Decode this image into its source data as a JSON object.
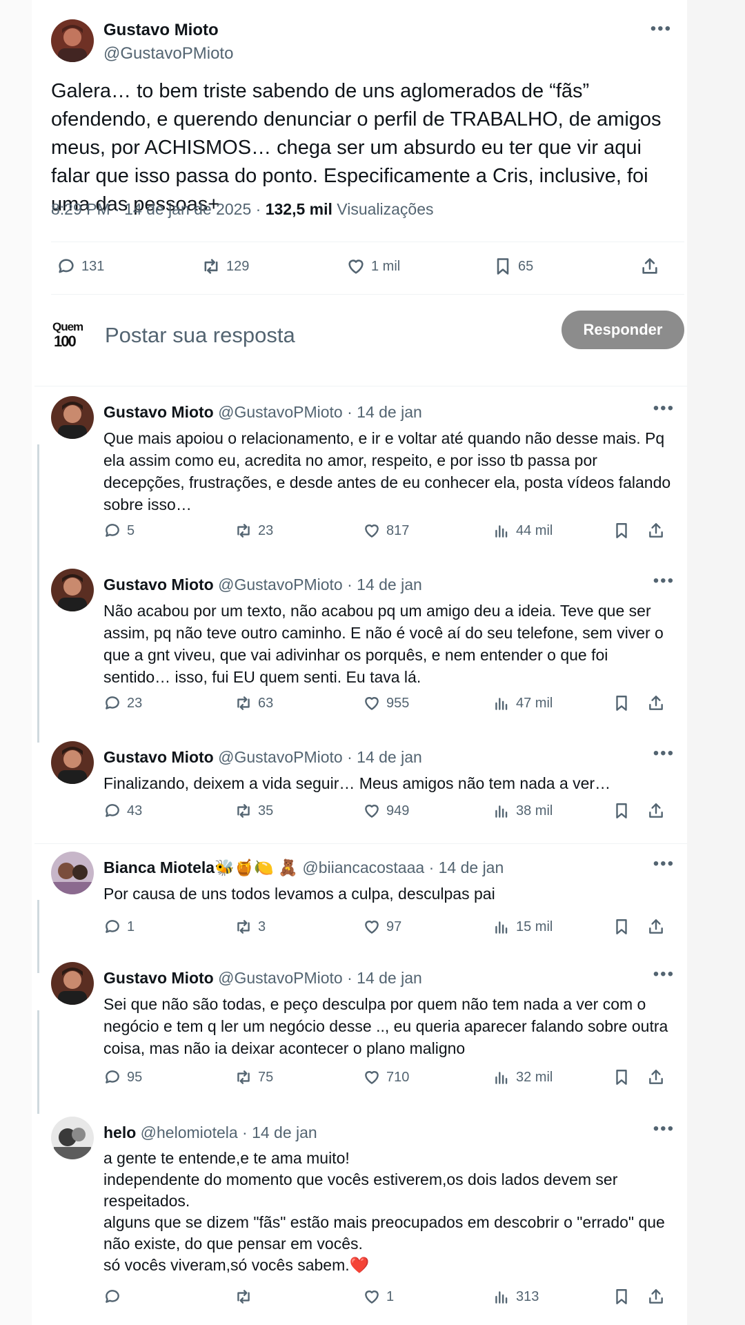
{
  "main_tweet": {
    "name": "Gustavo Mioto",
    "handle": "@GustavoPMioto",
    "text": "Galera… to bem triste sabendo de uns aglomerados de “fãs” ofendendo, e querendo denunciar o perfil de TRABALHO, de amigos meus, por ACHISMOS… chega ser um absurdo eu ter que vir aqui falar que isso passa do ponto. Especificamente a Cris, inclusive, foi uma das pessoas+",
    "time": "8:29 PM · 14 de jan de 2025 · ",
    "views_count": "132,5 mil",
    "views_label": " Visualizações",
    "replies": "131",
    "retweets": "129",
    "likes": "1 mil",
    "bookmarks": "65"
  },
  "reply_box": {
    "logo_top": "Quem",
    "logo_bottom": "100",
    "placeholder": "Postar sua resposta",
    "button": "Responder"
  },
  "replies": [
    {
      "name": "Gustavo Mioto",
      "handle": "@GustavoPMioto · 14 de jan",
      "text": "Que mais apoiou o relacionamento, e ir e voltar até quando não desse mais. Pq ela assim como eu, acredita no amor, respeito, e por isso tb passa por decepções, frustrações, e desde antes de eu conhecer ela, posta vídeos falando sobre isso…",
      "replies": "5",
      "retweets": "23",
      "likes": "817",
      "views": "44 mil"
    },
    {
      "name": "Gustavo Mioto",
      "handle": "@GustavoPMioto · 14 de jan",
      "text": "Não acabou por um texto, não acabou pq um amigo deu a ideia. Teve que ser assim, pq não teve outro caminho. E não é você aí do seu telefone, sem viver o que a gnt viveu, que vai adivinhar os porquês, e nem entender o que foi sentido… isso, fui EU quem senti. Eu tava lá.",
      "replies": "23",
      "retweets": "63",
      "likes": "955",
      "views": "47 mil"
    },
    {
      "name": "Gustavo Mioto",
      "handle": "@GustavoPMioto · 14 de jan",
      "text": "Finalizando, deixem a vida seguir…  Meus amigos não tem nada a ver…",
      "replies": "43",
      "retweets": "35",
      "likes": "949",
      "views": "38 mil"
    },
    {
      "name": "Bianca Miotela🐝🍯🍋 🧸",
      "handle": "@biiancacostaaa · 14 de jan",
      "text": "Por causa de uns todos levamos a culpa, desculpas pai",
      "replies": "1",
      "retweets": "3",
      "likes": "97",
      "views": "15 mil"
    },
    {
      "name": "Gustavo Mioto",
      "handle": "@GustavoPMioto · 14 de jan",
      "text": "Sei que não são todas, e peço desculpa por quem não tem nada a ver com o negócio e tem q ler um negócio desse .., eu queria aparecer falando sobre outra coisa, mas não ia deixar acontecer o plano maligno",
      "replies": "95",
      "retweets": "75",
      "likes": "710",
      "views": "32 mil"
    },
    {
      "name": "helo",
      "handle": "@helomiotela · 14 de jan",
      "lines": [
        "a gente te entende,e te ama muito!",
        "independente do momento que vocês estiverem,os dois lados devem ser respeitados.",
        "alguns que se dizem \"fãs\" estão mais preocupados em descobrir o \"errado\" que não existe, do que pensar em vocês.",
        "só vocês viveram,só vocês sabem.❤️"
      ],
      "replies": "",
      "retweets": "",
      "likes": "1",
      "views": "313"
    }
  ],
  "icons": {
    "reply": "reply-bubble-icon",
    "retweet": "retweet-icon",
    "like": "heart-icon",
    "views": "views-chart-icon",
    "bookmark": "bookmark-icon",
    "share": "share-icon",
    "more": "more-dots-icon"
  }
}
